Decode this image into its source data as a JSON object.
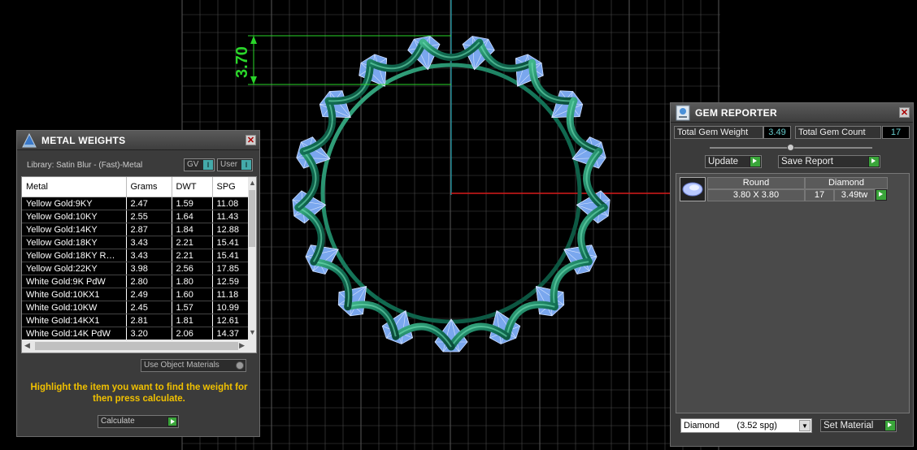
{
  "dimension": {
    "value": "3.70"
  },
  "metal_weights": {
    "title": "METAL WEIGHTS",
    "library": "Library: Satin Blur - (Fast)-Metal",
    "toggles": [
      {
        "label": "GV"
      },
      {
        "label": "User"
      }
    ],
    "columns": [
      "Metal",
      "Grams",
      "DWT",
      "SPG"
    ],
    "rows": [
      [
        "Yellow Gold:9KY",
        "2.47",
        "1.59",
        "11.08"
      ],
      [
        "Yellow Gold:10KY",
        "2.55",
        "1.64",
        "11.43"
      ],
      [
        "Yellow Gold:14KY",
        "2.87",
        "1.84",
        "12.88"
      ],
      [
        "Yellow Gold:18KY",
        "3.43",
        "2.21",
        "15.41"
      ],
      [
        "Yellow Gold:18KY R…",
        "3.43",
        "2.21",
        "15.41"
      ],
      [
        "Yellow Gold:22KY",
        "3.98",
        "2.56",
        "17.85"
      ],
      [
        "White Gold:9K PdW",
        "2.80",
        "1.80",
        "12.59"
      ],
      [
        "White Gold:10KX1",
        "2.49",
        "1.60",
        "11.18"
      ],
      [
        "White Gold:10KW",
        "2.45",
        "1.57",
        "10.99"
      ],
      [
        "White Gold:14KX1",
        "2.81",
        "1.81",
        "12.61"
      ],
      [
        "White Gold:14K PdW",
        "3.20",
        "2.06",
        "14.37"
      ]
    ],
    "use_object_materials": "Use Object Materials",
    "hint": "Highlight the item you want to find the weight for then press calculate.",
    "calculate": "Calculate"
  },
  "gem_reporter": {
    "title": "GEM REPORTER",
    "total_weight_label": "Total Gem Weight",
    "total_weight_value": "3.49",
    "total_count_label": "Total Gem Count",
    "total_count_value": "17",
    "update_button": "Update",
    "save_report_button": "Save Report",
    "gem_row": {
      "shape": "Round",
      "material": "Diamond",
      "size": "3.80 X 3.80",
      "count": "17",
      "weight": "3.49tw"
    },
    "material_select": "Diamond       (3.52 spg)",
    "set_material_button": "Set Material"
  },
  "colors": {
    "gem": "#7aa7ee",
    "metal": "#1b7a5a",
    "grid": "#4a4a4a",
    "accent": "#3aa53a"
  }
}
